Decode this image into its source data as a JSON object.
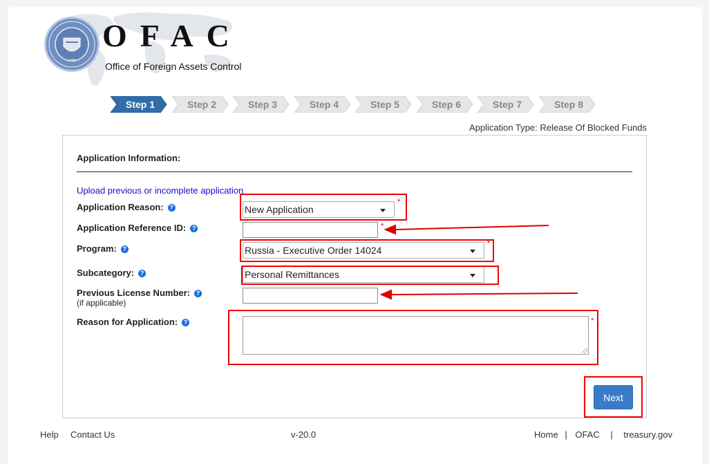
{
  "header": {
    "logo_title": "OFAC",
    "logo_subtitle": "Office of Foreign Assets Control",
    "seal_year": "1789"
  },
  "steps": [
    {
      "label": "Step 1",
      "active": true
    },
    {
      "label": "Step 2",
      "active": false
    },
    {
      "label": "Step 3",
      "active": false
    },
    {
      "label": "Step 4",
      "active": false
    },
    {
      "label": "Step 5",
      "active": false
    },
    {
      "label": "Step 6",
      "active": false
    },
    {
      "label": "Step 7",
      "active": false
    },
    {
      "label": "Step 8",
      "active": false
    }
  ],
  "application_type": "Application Type: Release Of Blocked Funds",
  "form": {
    "title": "Application Information:",
    "upload_link": "Upload previous or incomplete application",
    "reason_label": "Application Reason:",
    "reason_value": "New Application",
    "reference_label": "Application Reference ID:",
    "reference_value": "",
    "program_label": "Program:",
    "program_value": "Russia - Executive Order 14024",
    "subcategory_label": "Subcategory:",
    "subcategory_value": "Personal Remittances",
    "license_label": "Previous License Number:",
    "license_sublabel": "(if applicable)",
    "license_value": "",
    "reason_app_label": "Reason for Application:",
    "reason_app_value": "",
    "required_mark": "*",
    "help_mark": "?",
    "next_label": "Next"
  },
  "footer": {
    "help": "Help",
    "contact": "Contact Us",
    "version": "v-20.0",
    "home": "Home",
    "ofac": "OFAC",
    "treasury": "treasury.gov",
    "separator": "|"
  },
  "colors": {
    "step_active": "#2f6ea8",
    "step_inactive": "#e6e6e6",
    "annotation_red": "#e00000",
    "button_blue": "#3a7bc8"
  }
}
